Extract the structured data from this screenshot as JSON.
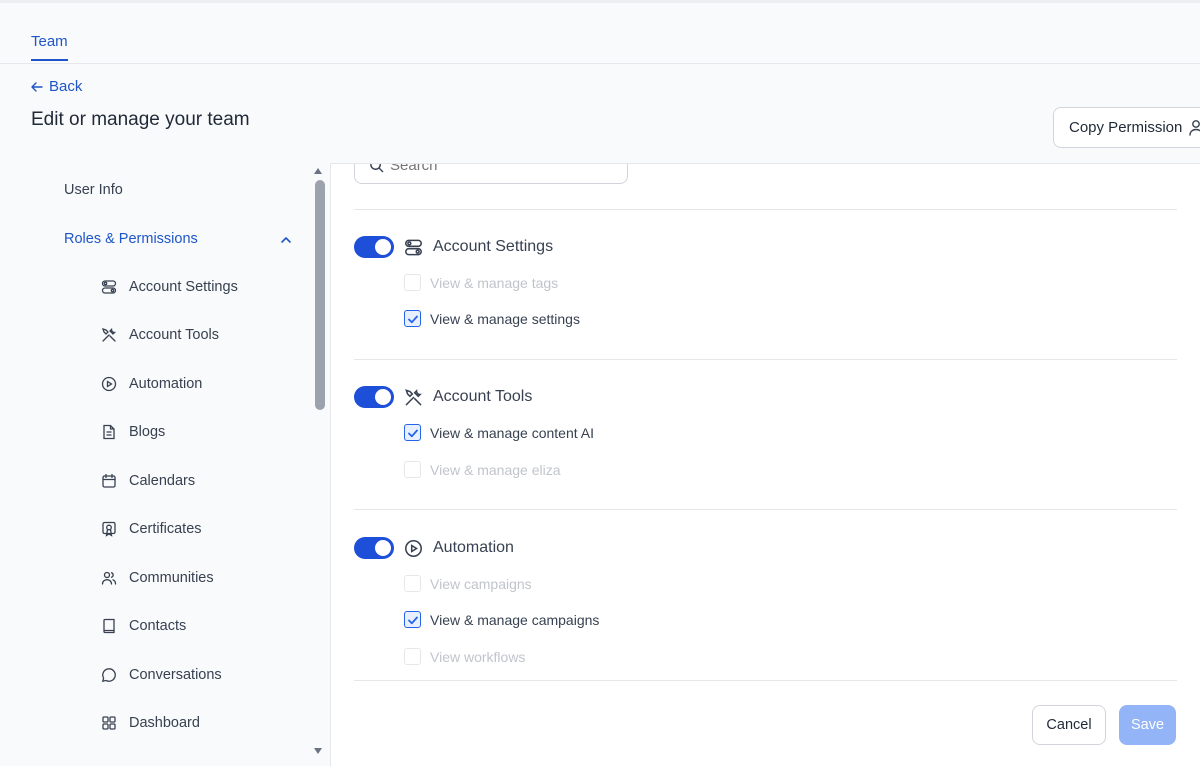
{
  "header": {
    "tab": "Team",
    "back_label": "Back",
    "title": "Edit or manage your team",
    "copy_permission_label": "Copy Permission"
  },
  "sidebar": {
    "user_info": "User Info",
    "roles_permissions": "Roles & Permissions",
    "items": [
      {
        "label": "Account Settings",
        "icon": "account-settings-icon"
      },
      {
        "label": "Account Tools",
        "icon": "tools-icon"
      },
      {
        "label": "Automation",
        "icon": "play-circle-icon"
      },
      {
        "label": "Blogs",
        "icon": "document-icon"
      },
      {
        "label": "Calendars",
        "icon": "calendar-icon"
      },
      {
        "label": "Certificates",
        "icon": "certificate-icon"
      },
      {
        "label": "Communities",
        "icon": "users-icon"
      },
      {
        "label": "Contacts",
        "icon": "book-icon"
      },
      {
        "label": "Conversations",
        "icon": "chat-icon"
      },
      {
        "label": "Dashboard",
        "icon": "grid-icon"
      }
    ]
  },
  "search": {
    "placeholder": "Search"
  },
  "sections": [
    {
      "title": "Account Settings",
      "enabled": true,
      "permissions": [
        {
          "label": "View & manage tags",
          "checked": false
        },
        {
          "label": "View & manage settings",
          "checked": true
        }
      ]
    },
    {
      "title": "Account Tools",
      "enabled": true,
      "permissions": [
        {
          "label": "View & manage content AI",
          "checked": true
        },
        {
          "label": "View & manage eliza",
          "checked": false
        }
      ]
    },
    {
      "title": "Automation",
      "enabled": true,
      "permissions": [
        {
          "label": "View campaigns",
          "checked": false
        },
        {
          "label": "View & manage campaigns",
          "checked": true
        },
        {
          "label": "View workflows",
          "checked": false
        }
      ]
    }
  ],
  "footer": {
    "cancel_label": "Cancel",
    "save_label": "Save"
  },
  "colors": {
    "accent": "#1e55c8",
    "toggle": "#1d4fd8",
    "save_disabled": "#93b4f6"
  }
}
